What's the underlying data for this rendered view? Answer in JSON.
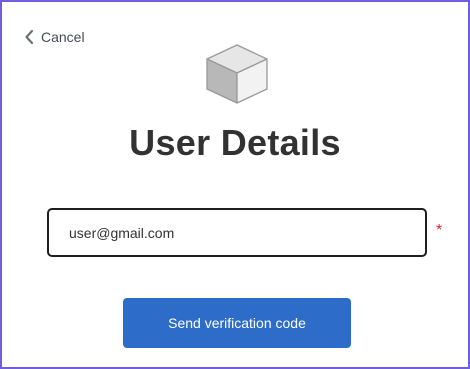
{
  "header": {
    "cancel_label": "Cancel",
    "cancel_icon": "chevron-left-icon",
    "logo_icon": "cube-icon"
  },
  "main": {
    "title": "User Details",
    "email_value": "user@gmail.com",
    "required_marker": "*",
    "send_button_label": "Send verification code"
  },
  "colors": {
    "accent": "#2d6cc8",
    "frame_border": "#6f5fe0",
    "required": "#e02020"
  }
}
